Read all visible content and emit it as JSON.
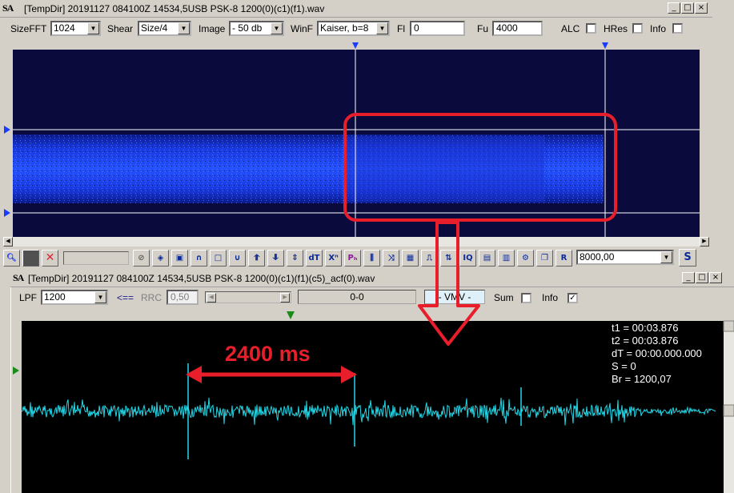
{
  "window1": {
    "title": "[TempDir] 20191127 084100Z 14534,5USB PSK-8 1200(0)(c1)(f1).wav",
    "logo": "SA",
    "controls": {
      "sizefft_label": "SizeFFT",
      "sizefft_value": "1024",
      "shear_label": "Shear",
      "shear_value": "Size/4",
      "image_label": "Image",
      "image_value": "- 50 db",
      "winf_label": "WinF",
      "winf_value": "Kaiser, b=8",
      "fl_label": "Fl",
      "fl_value": "0",
      "fu_label": "Fu",
      "fu_value": "4000",
      "alc_label": "ALC",
      "hres_label": "HRes",
      "info_label": "Info"
    },
    "toolbar": {
      "icons": [
        "zoom-icon",
        "save-icon",
        "cross-icon",
        "blank-field",
        "no-icon",
        "speaker-icon",
        "square-icon",
        "arch-icon",
        "rect-icon",
        "valley-icon",
        "arrows-up-icon",
        "arrows-down-icon",
        "arrows-both-icon",
        "dt-icon",
        "xn-icon",
        "ph-icon",
        "comb-icon",
        "swap-icon",
        "grid-icon",
        "pulse-icon",
        "tune-icon",
        "iq-icon",
        "spectrum-icon",
        "spectrum2-icon",
        "gear-icon",
        "copy-icon",
        "r-icon"
      ],
      "labels": {
        "dt": "dT",
        "xn": "Xⁿ",
        "ph": "Pₕ",
        "iq": "IQ",
        "r": "R"
      },
      "freq_value": "8000,00",
      "s_button": "S"
    }
  },
  "window2": {
    "title": "[TempDir] 20191127 084100Z 14534,5USB PSK-8 1200(0)(c1)(f1)(c5)_acf(0).wav",
    "logo": "SA",
    "controls": {
      "lpf_label": "LPF",
      "lpf_value": "1200",
      "back_label": "<==",
      "rrc_label": "RRC",
      "rrc_value": "0,50",
      "range_value": "0-0",
      "vmv_value": "- VMV -",
      "sum_label": "Sum",
      "info_label": "Info",
      "info_checked": "✓"
    },
    "readout": {
      "t1": "t1 = 00:03.876",
      "t2": "t2 = 00:03.876",
      "dt": "dT = 00:00.000.000",
      "s": "S = 0",
      "br": "Br = 1200,07"
    },
    "annotation": "2400 ms"
  },
  "colors": {
    "spectrogram_bg": "#0a0a3c",
    "signal": "#1e3cff",
    "waveform": "#22d8e8",
    "annotation": "#e81f2a"
  },
  "window_buttons": [
    "_",
    "□",
    "×"
  ]
}
